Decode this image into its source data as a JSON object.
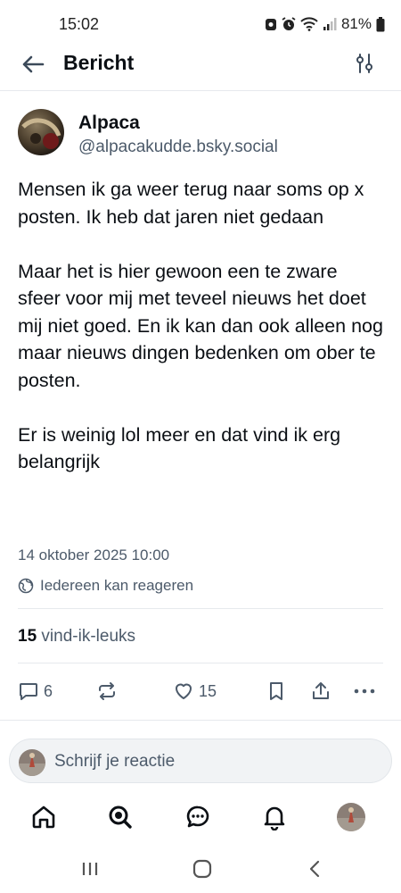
{
  "status_bar": {
    "time": "15:02",
    "battery": "81%"
  },
  "header": {
    "title": "Bericht"
  },
  "post": {
    "author": {
      "name": "Alpaca",
      "handle": "@alpacakudde.bsky.social"
    },
    "text": "Mensen ik ga weer terug naar soms op x posten. Ik heb dat jaren niet gedaan\n\nMaar het is hier gewoon een te zware sfeer voor mij met teveel nieuws het doet mij niet goed. En ik kan dan ook alleen nog maar nieuws dingen bedenken om ober te posten.\n\nEr is weinig lol meer en dat vind ik erg belangrijk",
    "date": "14 oktober 2025 10:00",
    "reply_setting": "Iedereen kan reageren",
    "likes_count": "15",
    "likes_label": "vind-ik-leuks",
    "actions": {
      "reply_count": "6",
      "like_count": "15"
    }
  },
  "composer": {
    "placeholder": "Schrijf je reactie"
  },
  "icons": {
    "back": "arrow-left-icon",
    "filter": "sliders-icon",
    "reply": "comment-icon",
    "repost": "repost-icon",
    "like": "heart-icon",
    "bookmark": "bookmark-icon",
    "share": "share-icon",
    "more": "more-icon",
    "home": "home-icon",
    "search": "search-icon",
    "chat": "chat-icon",
    "notifications": "bell-icon"
  },
  "colors": {
    "accent": "#0b0f14",
    "muted": "#4c5a6a",
    "divider": "#e6e9ed"
  }
}
